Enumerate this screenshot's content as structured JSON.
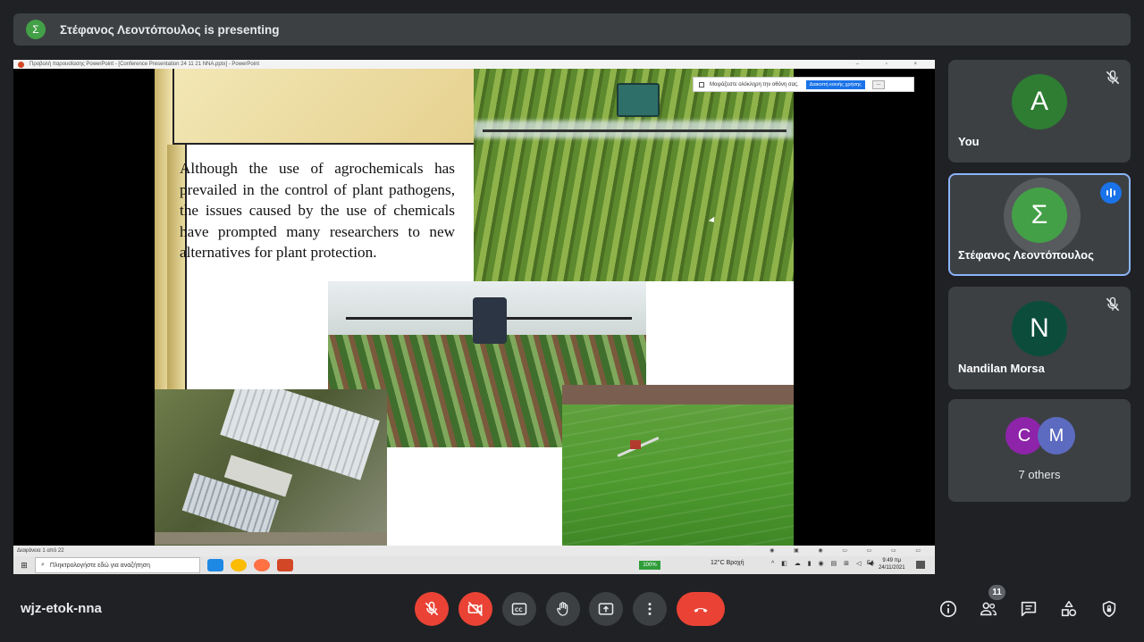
{
  "banner": {
    "avatar_initial": "Σ",
    "text": "Στέφανος Λεοντόπουλος is presenting"
  },
  "ppt": {
    "window_title": "Προβολή παρουσίασης PowerPoint - [Conference Presentation 24 11 21 ΝΝΑ.pptx] - PowerPoint",
    "window_controls": "– ▫ ×",
    "slide_text": "Although the use of agrochemicals has prevailed in the control of plant pathogens, the issues caused by the use of chemicals have prompted many researchers to new alternatives for plant protection.",
    "share_bar": {
      "text": "Μοιράζεστε ολόκληρη την οθόνη σας.",
      "button": "Διακοπή κοινής χρήσης",
      "more": "..."
    },
    "status_left": "Διαφάνεια 1 από 22",
    "status_icons": "◉ ▣ ◉ ▭ ▭ ▭ ▭",
    "taskbar": {
      "search_placeholder": "Πληκτρολογήστε εδώ για αναζήτηση",
      "battery": "100%",
      "weather": "12°C Βροχή",
      "tray": "^ ◧ ☁ ▮ ◉ ▤ ⊞ ◁ ◀",
      "lang": "ΕΛ",
      "time": "9:49 πμ",
      "date": "24/11/2021"
    }
  },
  "participants": [
    {
      "initial": "A",
      "name": "You",
      "color": "#2e7d32",
      "muted": true
    },
    {
      "initial": "Σ",
      "name": "Στέφανος Λεοντόπουλος",
      "color": "#43a047",
      "speaking": true
    },
    {
      "initial": "N",
      "name": "Nandilan Morsa",
      "color": "#0b4d3a",
      "muted": true
    }
  ],
  "others": {
    "initials": [
      "C",
      "M"
    ],
    "colors": [
      "#8e24aa",
      "#5c6bc0"
    ],
    "label": "7 others"
  },
  "bottom": {
    "meeting_code": "wjz-etok-nna",
    "people_count": "11"
  },
  "colors": {
    "accent": "#8ab4f8",
    "danger": "#ea4335",
    "surface": "#3c4043",
    "background": "#202124"
  }
}
